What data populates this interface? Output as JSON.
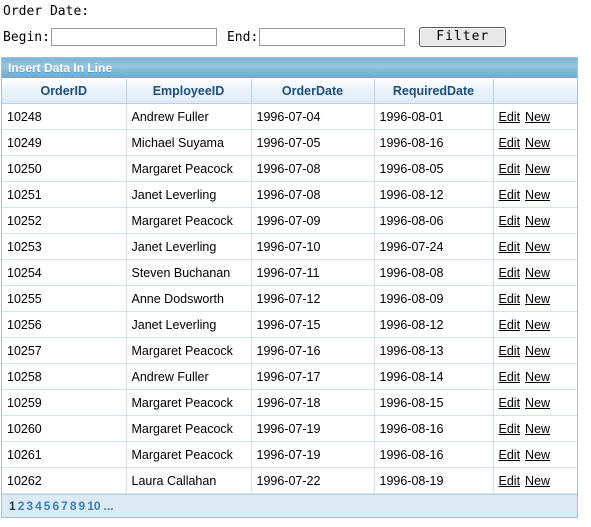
{
  "filter": {
    "title": "Order Date:",
    "begin_label": "Begin:",
    "begin_value": "",
    "begin_placeholder": "",
    "end_label": "End:",
    "end_value": "",
    "end_placeholder": "",
    "button_label": "Filter"
  },
  "panel": {
    "title": "Insert Data In Line"
  },
  "grid": {
    "columns": [
      "OrderID",
      "EmployeeID",
      "OrderDate",
      "RequiredDate",
      ""
    ],
    "actions": {
      "edit_label": "Edit",
      "new_label": "New"
    },
    "rows": [
      {
        "order_id": "10248",
        "employee": "Andrew Fuller",
        "order_date": "1996-07-04",
        "required_date": "1996-08-01"
      },
      {
        "order_id": "10249",
        "employee": "Michael Suyama",
        "order_date": "1996-07-05",
        "required_date": "1996-08-16"
      },
      {
        "order_id": "10250",
        "employee": "Margaret Peacock",
        "order_date": "1996-07-08",
        "required_date": "1996-08-05"
      },
      {
        "order_id": "10251",
        "employee": "Janet Leverling",
        "order_date": "1996-07-08",
        "required_date": "1996-08-12"
      },
      {
        "order_id": "10252",
        "employee": "Margaret Peacock",
        "order_date": "1996-07-09",
        "required_date": "1996-08-06"
      },
      {
        "order_id": "10253",
        "employee": "Janet Leverling",
        "order_date": "1996-07-10",
        "required_date": "1996-07-24"
      },
      {
        "order_id": "10254",
        "employee": "Steven Buchanan",
        "order_date": "1996-07-11",
        "required_date": "1996-08-08"
      },
      {
        "order_id": "10255",
        "employee": "Anne Dodsworth",
        "order_date": "1996-07-12",
        "required_date": "1996-08-09"
      },
      {
        "order_id": "10256",
        "employee": "Janet Leverling",
        "order_date": "1996-07-15",
        "required_date": "1996-08-12"
      },
      {
        "order_id": "10257",
        "employee": "Margaret Peacock",
        "order_date": "1996-07-16",
        "required_date": "1996-08-13"
      },
      {
        "order_id": "10258",
        "employee": "Andrew Fuller",
        "order_date": "1996-07-17",
        "required_date": "1996-08-14"
      },
      {
        "order_id": "10259",
        "employee": "Margaret Peacock",
        "order_date": "1996-07-18",
        "required_date": "1996-08-15"
      },
      {
        "order_id": "10260",
        "employee": "Margaret Peacock",
        "order_date": "1996-07-19",
        "required_date": "1996-08-16"
      },
      {
        "order_id": "10261",
        "employee": "Margaret Peacock",
        "order_date": "1996-07-19",
        "required_date": "1996-08-16"
      },
      {
        "order_id": "10262",
        "employee": "Laura Callahan",
        "order_date": "1996-07-22",
        "required_date": "1996-08-19"
      }
    ]
  },
  "pager": {
    "current_page": "1",
    "pages": [
      "1",
      "2",
      "3",
      "4",
      "5",
      "6",
      "7",
      "8",
      "9",
      "10"
    ],
    "ellipsis": "..."
  },
  "colors": {
    "panel_header_blue": "#8abbd9",
    "grid_border": "#9ec3dd",
    "header_text": "#1f4e79",
    "pager_bg": "#dceaf5",
    "link": "#3a7fb5"
  }
}
